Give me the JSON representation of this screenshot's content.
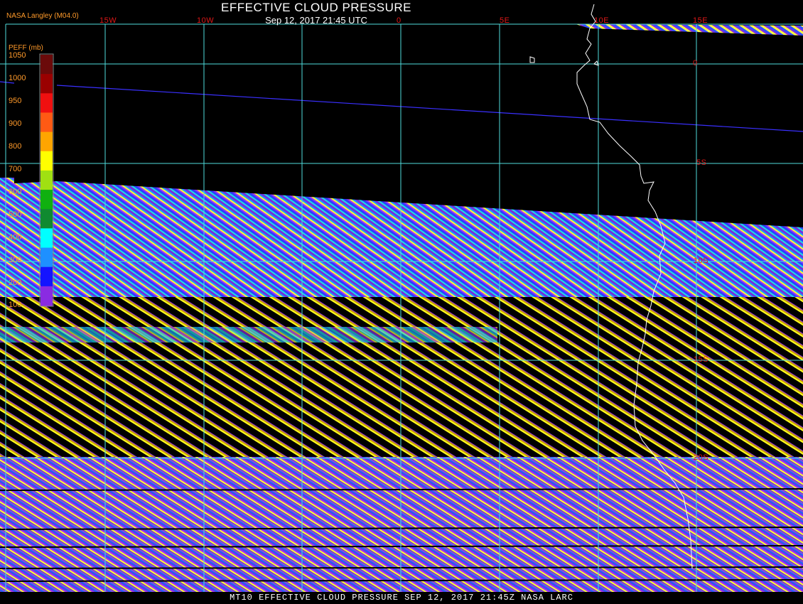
{
  "header": {
    "title": "EFFECTIVE CLOUD PRESSURE",
    "subtitle": "Sep 12, 2017 21:45 UTC",
    "credit": "NASA Langley (M04.0)"
  },
  "colorbar": {
    "label": "PEFF (mb)",
    "ticks": [
      "1050",
      "1000",
      "950",
      "900",
      "800",
      "700",
      "600",
      "500",
      "400",
      "300",
      "200",
      "100"
    ],
    "colors": [
      "#6b0a0a",
      "#9a0000",
      "#f01010",
      "#ff5a14",
      "#ffa500",
      "#ffff00",
      "#a0e012",
      "#10b010",
      "#108a30",
      "#00ffff",
      "#1e90ff",
      "#1414ff",
      "#8a2be2"
    ]
  },
  "graticule": {
    "lon_labels": [
      "15W",
      "10W",
      "0",
      "5E",
      "10E",
      "15E"
    ],
    "lat_labels": [
      "0",
      "5S",
      "10S",
      "15S",
      "20S"
    ],
    "grid_color": "#4fdcdc",
    "label_color": "#e01818"
  },
  "footer": "MT10  EFFECTIVE CLOUD PRESSURE   SEP 12, 2017 21:45Z   NASA LARC",
  "overlays": {
    "equator_track_color": "#3a30ff",
    "coastline_color": "#ffffff"
  }
}
